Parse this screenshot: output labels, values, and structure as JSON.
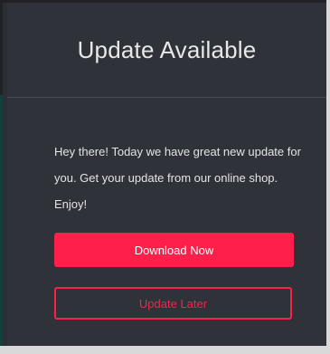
{
  "dialog": {
    "title": "Update Available",
    "message": "Hey there! Today we have great new update for you. Get your update from our online shop. Enjoy!",
    "primary_button": "Download Now",
    "secondary_button": "Update Later"
  },
  "colors": {
    "accent": "#ff1f4b",
    "background": "#2f3238",
    "text": "#e3e4e6"
  }
}
